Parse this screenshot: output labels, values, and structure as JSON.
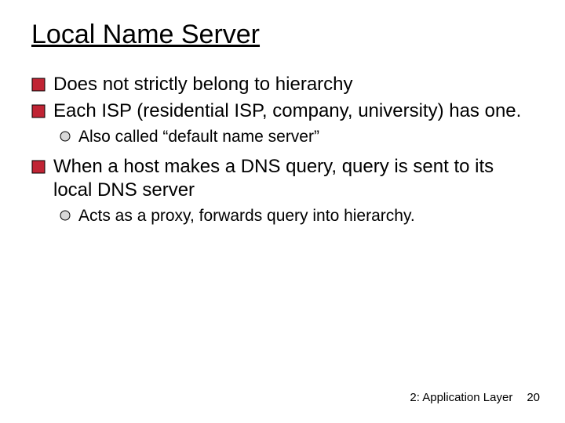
{
  "title": "Local Name Server",
  "bullets": {
    "b1": "Does not strictly belong to hierarchy",
    "b2": "Each ISP (residential ISP, company, university) has one.",
    "b2a": "Also called “default name server”",
    "b3": "When a host makes a DNS query, query is sent to its local DNS server",
    "b3a": "Acts as a proxy, forwards query into hierarchy."
  },
  "footer": {
    "chapter": "2: Application Layer",
    "page": "20"
  },
  "colors": {
    "bullet_fill": "#c02434",
    "bullet_stroke": "#000000",
    "sub_fill": "#d9d9d9"
  }
}
